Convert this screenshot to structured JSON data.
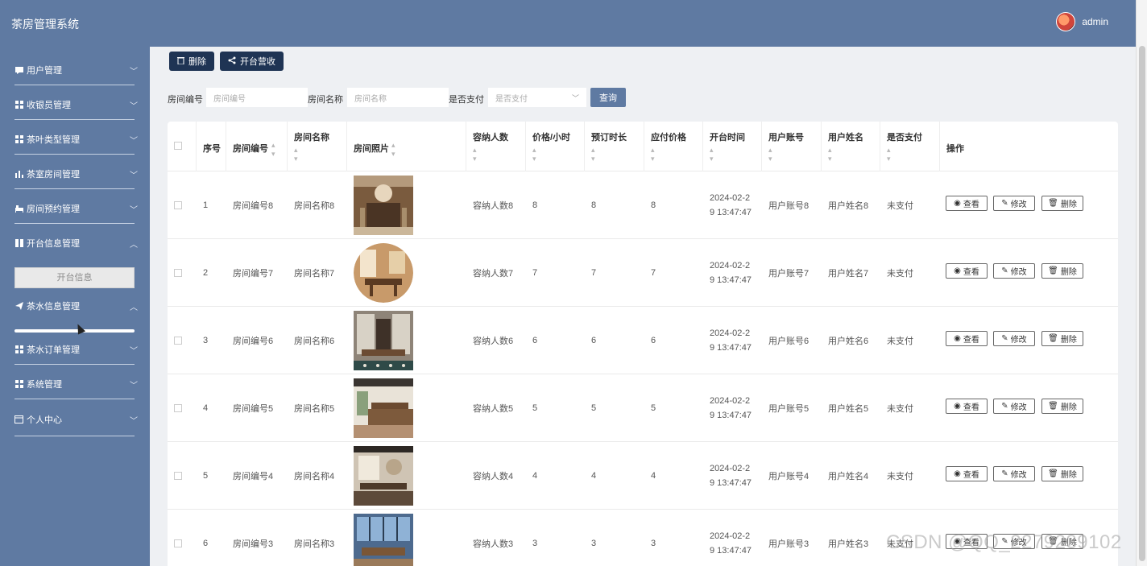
{
  "header": {
    "title": "茶房管理系统",
    "user_name": "admin"
  },
  "sidebar": {
    "items": [
      {
        "label": "用户管理",
        "icon": "chat-icon",
        "chevron": "﹀"
      },
      {
        "label": "收银员管理",
        "icon": "grid-icon",
        "chevron": "﹀"
      },
      {
        "label": "茶叶类型管理",
        "icon": "grid-icon",
        "chevron": "﹀"
      },
      {
        "label": "茶室房间管理",
        "icon": "bar-chart-icon",
        "chevron": "﹀"
      },
      {
        "label": "房间预约管理",
        "icon": "bed-icon",
        "chevron": "﹀"
      },
      {
        "label": "开台信息管理",
        "icon": "book-icon",
        "chevron": "︿"
      },
      {
        "label": "茶水信息管理",
        "icon": "send-icon",
        "chevron": "︿"
      },
      {
        "label": "茶水订单管理",
        "icon": "grid-icon",
        "chevron": "﹀"
      },
      {
        "label": "系统管理",
        "icon": "grid-icon",
        "chevron": "﹀"
      },
      {
        "label": "个人中心",
        "icon": "card-icon",
        "chevron": "﹀"
      }
    ],
    "submenu_item": "开台信息"
  },
  "toolbar": {
    "delete_label": "删除",
    "open_label": "开台营收"
  },
  "search": {
    "room_no_label": "房间编号",
    "room_no_placeholder": "房间编号",
    "room_name_label": "房间名称",
    "room_name_placeholder": "房间名称",
    "paid_label": "是否支付",
    "paid_placeholder": "是否支付",
    "query_label": "查询"
  },
  "table": {
    "headers": {
      "index": "序号",
      "room_no": "房间编号",
      "room_name": "房间名称",
      "photo": "房间照片",
      "capacity": "容纳人数",
      "price": "价格/小时",
      "duration": "预订时长",
      "amount": "应付价格",
      "open_time": "开台时间",
      "account": "用户账号",
      "username": "用户姓名",
      "paid": "是否支付",
      "actions": "操作"
    },
    "rows": [
      {
        "index": "1",
        "room_no": "房间编号8",
        "room_name": "房间名称8",
        "capacity": "容纳人数8",
        "price": "8",
        "duration": "8",
        "amount": "8",
        "time_line1": "2024-02-2",
        "time_line2": "9 13:47:47",
        "account": "用户账号8",
        "username": "用户姓名8",
        "paid": "未支付"
      },
      {
        "index": "2",
        "room_no": "房间编号7",
        "room_name": "房间名称7",
        "capacity": "容纳人数7",
        "price": "7",
        "duration": "7",
        "amount": "7",
        "time_line1": "2024-02-2",
        "time_line2": "9 13:47:47",
        "account": "用户账号7",
        "username": "用户姓名7",
        "paid": "未支付"
      },
      {
        "index": "3",
        "room_no": "房间编号6",
        "room_name": "房间名称6",
        "capacity": "容纳人数6",
        "price": "6",
        "duration": "6",
        "amount": "6",
        "time_line1": "2024-02-2",
        "time_line2": "9 13:47:47",
        "account": "用户账号6",
        "username": "用户姓名6",
        "paid": "未支付"
      },
      {
        "index": "4",
        "room_no": "房间编号5",
        "room_name": "房间名称5",
        "capacity": "容纳人数5",
        "price": "5",
        "duration": "5",
        "amount": "5",
        "time_line1": "2024-02-2",
        "time_line2": "9 13:47:47",
        "account": "用户账号5",
        "username": "用户姓名5",
        "paid": "未支付"
      },
      {
        "index": "5",
        "room_no": "房间编号4",
        "room_name": "房间名称4",
        "capacity": "容纳人数4",
        "price": "4",
        "duration": "4",
        "amount": "4",
        "time_line1": "2024-02-2",
        "time_line2": "9 13:47:47",
        "account": "用户账号4",
        "username": "用户姓名4",
        "paid": "未支付"
      },
      {
        "index": "6",
        "room_no": "房间编号3",
        "room_name": "房间名称3",
        "capacity": "容纳人数3",
        "price": "3",
        "duration": "3",
        "amount": "3",
        "time_line1": "2024-02-2",
        "time_line2": "9 13:47:47",
        "account": "用户账号3",
        "username": "用户姓名3",
        "paid": "未支付"
      }
    ],
    "actions": {
      "view": "查看",
      "edit": "修改",
      "delete": "删除"
    }
  },
  "watermark": "CSDN @QQ_2279239102",
  "colors": {
    "nav": "#5f7aa2",
    "dark_button": "#1f3454",
    "page_bg": "#eef0f3"
  }
}
